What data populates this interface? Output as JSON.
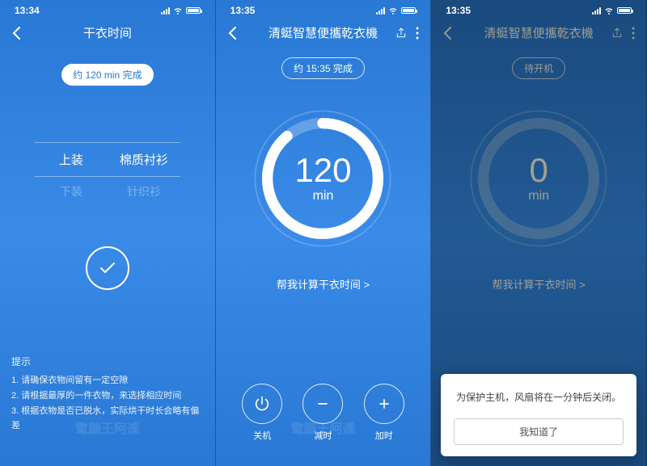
{
  "status": {
    "time1": "13:34",
    "time2": "13:35",
    "time3": "13:35"
  },
  "screen1": {
    "title": "干衣时间",
    "pill": "约 120 min 完成",
    "picker": {
      "selected_left": "上装",
      "selected_right": "棉质衬衫",
      "dim_left": "下装",
      "dim_right": "针织衫"
    },
    "tips_title": "提示",
    "tip1": "1. 请确保衣物间留有一定空隙",
    "tip2": "2. 请根据最厚的一件衣物，来选择相应时间",
    "tip3": "3. 根据衣物是否已脱水，实际烘干时长会略有偏差"
  },
  "screen2": {
    "title": "清蜓智慧便攜乾衣機",
    "pill": "约 15:35 完成",
    "dial_value": "120",
    "dial_unit": "min",
    "calc_link": "帮我计算干衣时间 >",
    "btn_power": "关机",
    "btn_minus": "减时",
    "btn_plus": "加时"
  },
  "screen3": {
    "title": "清蜓智慧便攜乾衣機",
    "pill": "待开机",
    "dial_value": "0",
    "dial_unit": "min",
    "calc_link": "帮我计算干衣时间 >",
    "modal_msg": "为保护主机，风扇将在一分钟后关闭。",
    "modal_btn": "我知道了"
  },
  "watermark": "電腦王阿達"
}
